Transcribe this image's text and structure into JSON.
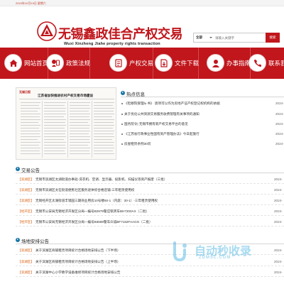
{
  "topbar": {
    "date": "2024年10月19日 星期六"
  },
  "header": {
    "logo_cn": "无锡鑫政佳合产权交易",
    "logo_en": "Wuxi Xinzheng Jiahe property rights transaction"
  },
  "search": {
    "scope": "全部",
    "placeholder": "请输入关键字",
    "button_label": "搜索"
  },
  "nav": {
    "items": [
      {
        "label": "网站首页",
        "icon": "home-icon"
      },
      {
        "label": "政策法规",
        "icon": "policy-icon"
      },
      {
        "label": "产权交易",
        "icon": "transaction-icon"
      },
      {
        "label": "文件下载",
        "icon": "download-icon"
      },
      {
        "label": "办事指南",
        "icon": "guide-icon"
      },
      {
        "label": "联系我",
        "icon": "contact-icon"
      }
    ]
  },
  "news_image": {
    "masthead": "无锡日报",
    "headline": "江苏省加快推进农村产权交易市场建设"
  },
  "hot_news": {
    "title": "热点信息",
    "items": [
      {
        "text": "《检察院受理lu 书》 逐项可以作为房地产证产权登记权机构的依据",
        "date": "2024-"
      },
      {
        "text": "关于优化公共资源交易服务收费管理有关事项的通知",
        "date": "2024-"
      },
      {
        "text": "国务院令| 无锡市拥有新产权交易平台的意见",
        "date": "2024-"
      },
      {
        "text": "《江苏省行政事业性国有资产管理办法》今日起施行",
        "date": "2024-"
      },
      {
        "text": "房屋租赁条例30问",
        "date": "2024-"
      }
    ]
  },
  "transaction": {
    "title": "交易公告",
    "items": [
      {
        "tag": "【滨湖区】",
        "text": "无锡市滨湖区太湖街道办事处-洗衣机、空调、显示器、投影机、扫描仪等资产报废（三批）",
        "date": "2024-"
      },
      {
        "tag": "【滨湖区】",
        "text": "无锡市滨湖区太在街道便民社区服务退休综合楼店铺-三年租赁使用权",
        "date": "2024-"
      },
      {
        "tag": "【滨湖区】",
        "text": "无锡经开区太湖街道丰镜园三期商业用房10号楼60-1（内庭：30-1）-三年租赁使用权",
        "date": "2024-"
      },
      {
        "tag": "【经开区】",
        "text": "无锡市公安局无锡经济开发区分局—编号B2979警应钒转车BH7200AX（二批）",
        "date": "2024-"
      },
      {
        "tag": "【经开区】",
        "text": "无锡市公安局无锡经济开发区分局—编号B3589警车众诚BF7162FAAGG（二批）",
        "date": "2024-"
      }
    ]
  },
  "venue": {
    "title": "场地安排公告",
    "items": [
      {
        "tag": "【滨湖区】",
        "text": "关于滨湖区商铺租赁项目统计合格场地安排公告（下半场）",
        "date": "2024-"
      },
      {
        "tag": "【滨湖区】",
        "text": "关于滨湖区商铺租赁项目统计合格场地安排公告（上半场）",
        "date": "2024-"
      },
      {
        "tag": "【滨湖区】",
        "text": "关于滨湖中心小学教学设备维修项目统计合格场地安排公告",
        "date": "2024-"
      }
    ]
  },
  "watermark": {
    "text": "自动秒收录",
    "url": "ZDMSL.COM"
  }
}
